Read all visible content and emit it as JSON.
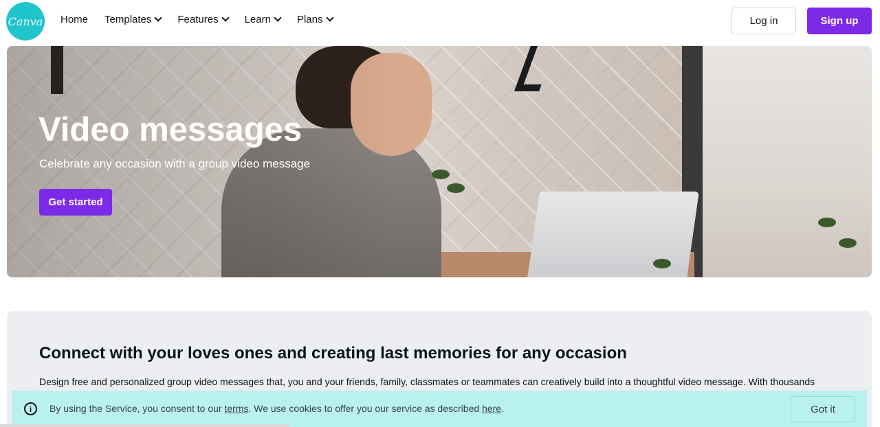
{
  "brand": {
    "logo_text": "Canva",
    "accent": "#7d2ae8",
    "logo_color": "#20c4cb"
  },
  "nav": {
    "items": [
      {
        "label": "Home",
        "has_dropdown": false
      },
      {
        "label": "Templates",
        "has_dropdown": true
      },
      {
        "label": "Features",
        "has_dropdown": true
      },
      {
        "label": "Learn",
        "has_dropdown": true
      },
      {
        "label": "Plans",
        "has_dropdown": true
      }
    ],
    "login_label": "Log in",
    "signup_label": "Sign up"
  },
  "hero": {
    "title": "Video messages",
    "subtitle": "Celebrate any occasion with a group video message",
    "cta_label": "Get started"
  },
  "section": {
    "title": "Connect with your loves ones and creating last memories for any occasion",
    "body": "Design free and personalized group video messages that, you and your friends, family, classmates or teammates can creatively build into a thoughtful video message. With thousands"
  },
  "cookie": {
    "text_before": "By using the Service, you consent to our ",
    "terms_label": "terms",
    "text_middle": ". We use cookies to offer you our service as described ",
    "here_label": "here",
    "text_after": ".",
    "button_label": "Got it"
  }
}
